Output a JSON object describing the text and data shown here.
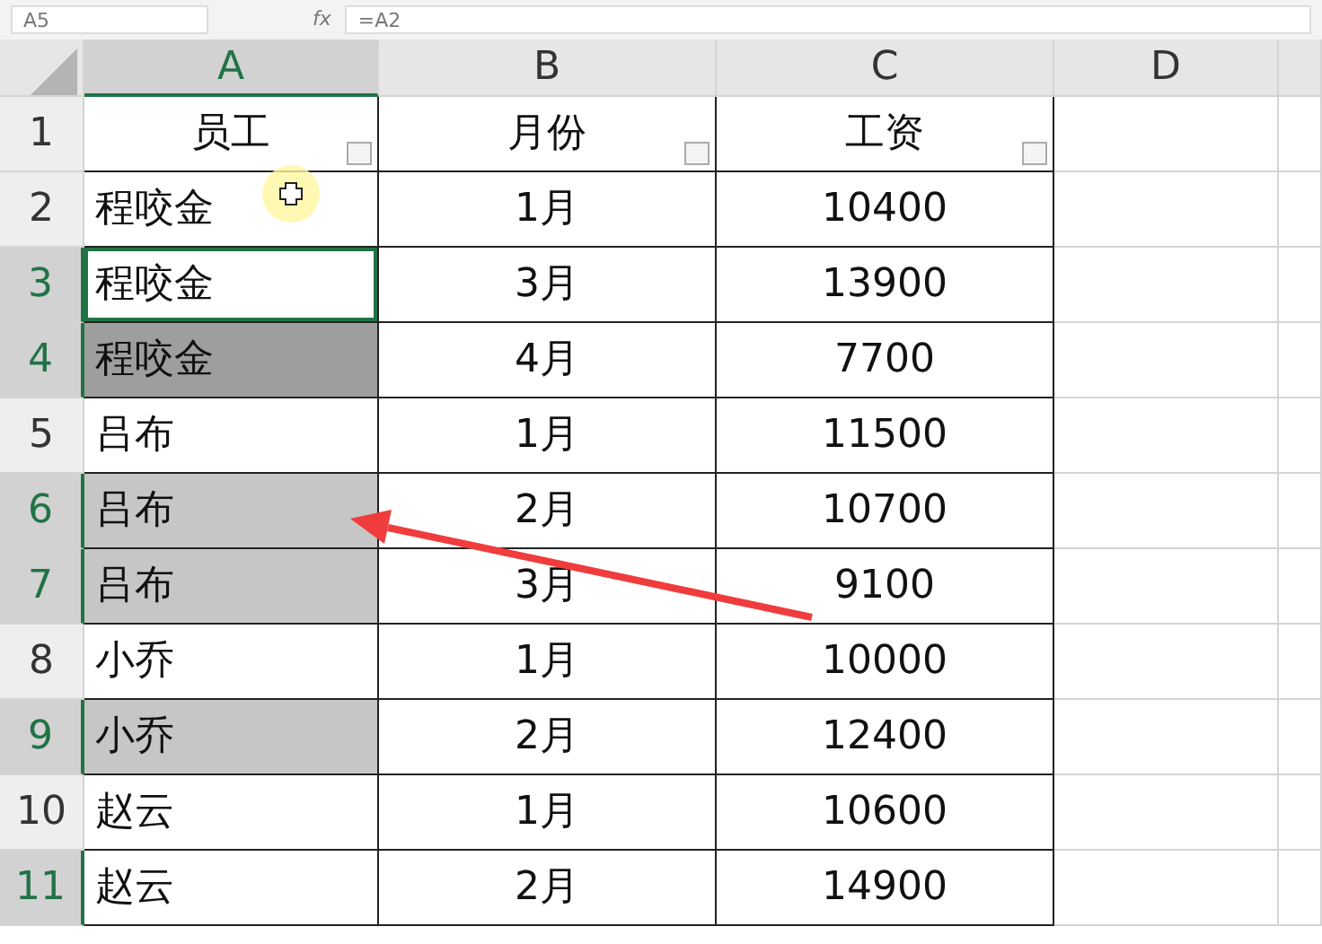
{
  "formula_bar": {
    "name_box": "A5",
    "fx": "fx",
    "formula": "=A2"
  },
  "columns": [
    {
      "label": "A",
      "selected": true
    },
    {
      "label": "B",
      "selected": false
    },
    {
      "label": "C",
      "selected": false
    },
    {
      "label": "D",
      "selected": false
    }
  ],
  "rows": [
    {
      "kind": "header",
      "number": "1",
      "selected": false,
      "active": false,
      "cells": [
        "员工",
        "月份",
        "工资"
      ]
    },
    {
      "kind": "data",
      "number": "2",
      "selected": false,
      "active": false,
      "cells": [
        "程咬金",
        "1月",
        "10400"
      ]
    },
    {
      "kind": "data",
      "number": "3",
      "selected": true,
      "active": true,
      "cells": [
        "程咬金",
        "3月",
        "13900"
      ]
    },
    {
      "kind": "data",
      "number": "4",
      "selected": true,
      "active": false,
      "color": "#9e9e9e",
      "cells": [
        "程咬金",
        "4月",
        "7700"
      ]
    },
    {
      "kind": "data",
      "number": "5",
      "selected": false,
      "active": false,
      "cells": [
        "吕布",
        "1月",
        "11500"
      ]
    },
    {
      "kind": "data",
      "number": "6",
      "selected": true,
      "active": false,
      "color": "#c6c6c6",
      "cells": [
        "吕布",
        "2月",
        "10700"
      ]
    },
    {
      "kind": "data",
      "number": "7",
      "selected": true,
      "active": false,
      "color": "#c6c6c6",
      "cells": [
        "吕布",
        "3月",
        "9100"
      ]
    },
    {
      "kind": "data",
      "number": "8",
      "selected": false,
      "active": false,
      "cells": [
        "小乔",
        "1月",
        "10000"
      ]
    },
    {
      "kind": "data",
      "number": "9",
      "selected": true,
      "active": false,
      "color": "#c6c6c6",
      "cells": [
        "小乔",
        "2月",
        "12400"
      ]
    },
    {
      "kind": "data",
      "number": "10",
      "selected": false,
      "active": false,
      "cells": [
        "赵云",
        "1月",
        "10600"
      ]
    },
    {
      "kind": "data",
      "number": "11",
      "selected": true,
      "active": false,
      "cells": [
        "赵云",
        "2月",
        "14900"
      ]
    }
  ]
}
